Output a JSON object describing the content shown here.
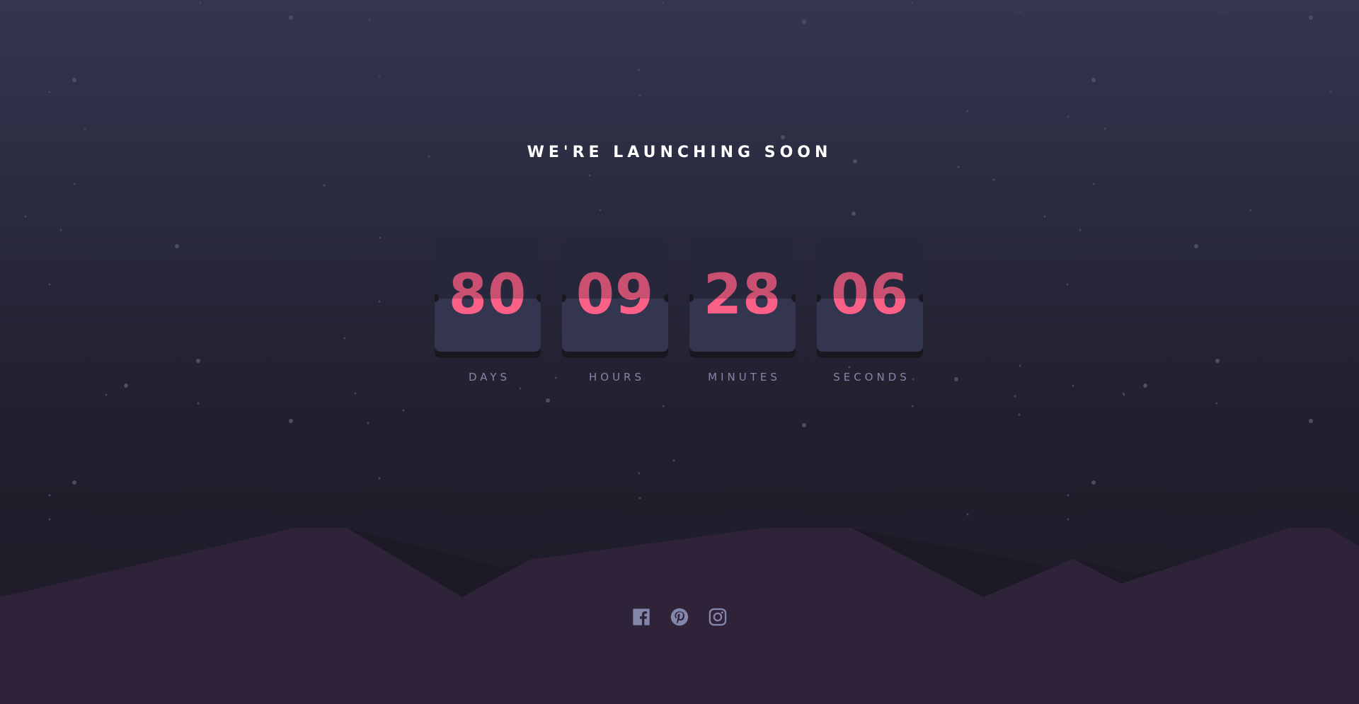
{
  "heading": "WE'RE LAUNCHING SOON",
  "countdown": [
    {
      "value": "80",
      "label": "DAYS"
    },
    {
      "value": "09",
      "label": "HOURS"
    },
    {
      "value": "28",
      "label": "MINUTES"
    },
    {
      "value": "06",
      "label": "SECONDS"
    }
  ],
  "social": [
    {
      "icon": "facebook-icon"
    },
    {
      "icon": "pinterest-icon"
    },
    {
      "icon": "instagram-icon"
    }
  ],
  "colors": {
    "digits": "#fb6087",
    "card": "#343650",
    "label": "#8486a9",
    "social_icon": "#8486a9",
    "hills": "#2f2339"
  }
}
